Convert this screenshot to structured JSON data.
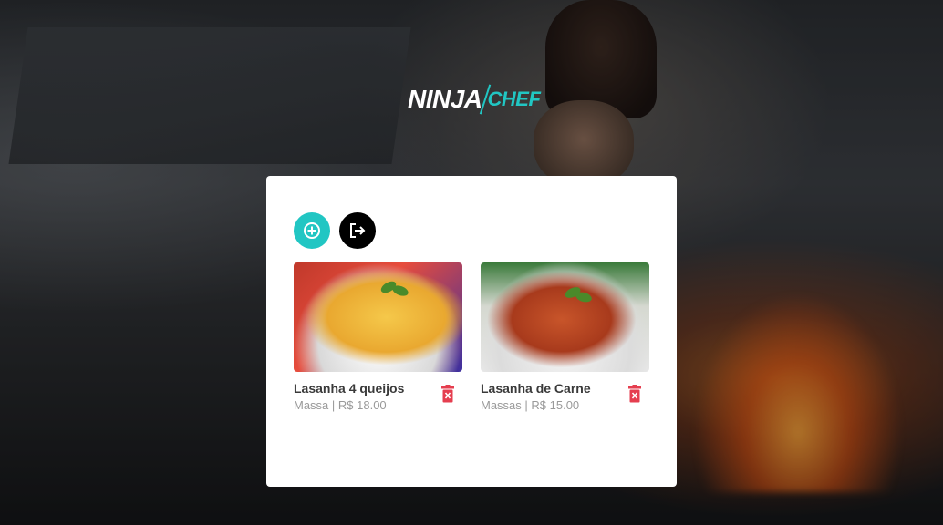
{
  "brand": {
    "part1": "NINJA",
    "part2": "CHEF"
  },
  "actions": {
    "add_icon": "plus-circle-icon",
    "logout_icon": "logout-icon"
  },
  "colors": {
    "accent": "#21c6c3",
    "danger": "#e53e4f",
    "card": "#ffffff"
  },
  "products": [
    {
      "name": "Lasanha 4 queijos",
      "subtitle": "Massa | R$ 18.00",
      "delete_icon": "trash-icon"
    },
    {
      "name": "Lasanha de Carne",
      "subtitle": "Massas | R$ 15.00",
      "delete_icon": "trash-icon"
    }
  ]
}
